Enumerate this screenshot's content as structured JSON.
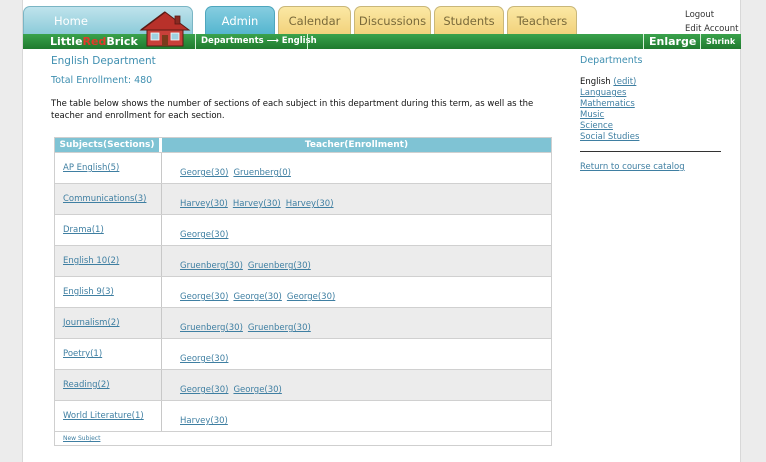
{
  "nav": {
    "tabs": [
      {
        "label": "Home"
      },
      {
        "label": "Admin"
      },
      {
        "label": "Calendar"
      },
      {
        "label": "Discussions"
      },
      {
        "label": "Students"
      },
      {
        "label": "Teachers"
      }
    ],
    "logout": "Logout",
    "edit_account": "Edit Account"
  },
  "brand": {
    "part1": "Little",
    "part2": "Red",
    "part3": "Brick"
  },
  "greenbar": {
    "breadcrumb": "Departments ⟶ English",
    "enlarge": "Enlarge",
    "shrink": "Shrink"
  },
  "main": {
    "title": "English Department",
    "enrollment": "Total Enrollment: 480",
    "description": "The table below shows the number of sections of each subject in this department during this term, as well as the teacher and enrollment for each section.",
    "table": {
      "headers": [
        "Subjects(Sections)",
        "Teacher(Enrollment)"
      ],
      "rows": [
        {
          "subject": "AP English(5)",
          "teachers": [
            "George(30)",
            "Gruenberg(0)"
          ]
        },
        {
          "subject": "Communications(3)",
          "teachers": [
            "Harvey(30)",
            "Harvey(30)",
            "Harvey(30)"
          ]
        },
        {
          "subject": "Drama(1)",
          "teachers": [
            "George(30)"
          ]
        },
        {
          "subject": "English 10(2)",
          "teachers": [
            "Gruenberg(30)",
            "Gruenberg(30)"
          ]
        },
        {
          "subject": "English 9(3)",
          "teachers": [
            "George(30)",
            "George(30)",
            "George(30)"
          ]
        },
        {
          "subject": "Journalism(2)",
          "teachers": [
            "Gruenberg(30)",
            "Gruenberg(30)"
          ]
        },
        {
          "subject": "Poetry(1)",
          "teachers": [
            "George(30)"
          ]
        },
        {
          "subject": "Reading(2)",
          "teachers": [
            "George(30)",
            "George(30)"
          ]
        },
        {
          "subject": "World Literature(1)",
          "teachers": [
            "Harvey(30)"
          ]
        }
      ],
      "new_subject": "New Subject"
    }
  },
  "sidebar": {
    "title": "Departments",
    "current": "English",
    "edit": "(edit)",
    "departments": [
      "Languages",
      "Mathematics",
      "Music",
      "Science",
      "Social Studies"
    ],
    "return_link": "Return to course catalog"
  },
  "colors": {
    "accent": "#3f8fb0",
    "brand_green": "#1f7a2e",
    "tab_blue": "#55b6cf",
    "tab_yellow": "#f2d27c"
  }
}
